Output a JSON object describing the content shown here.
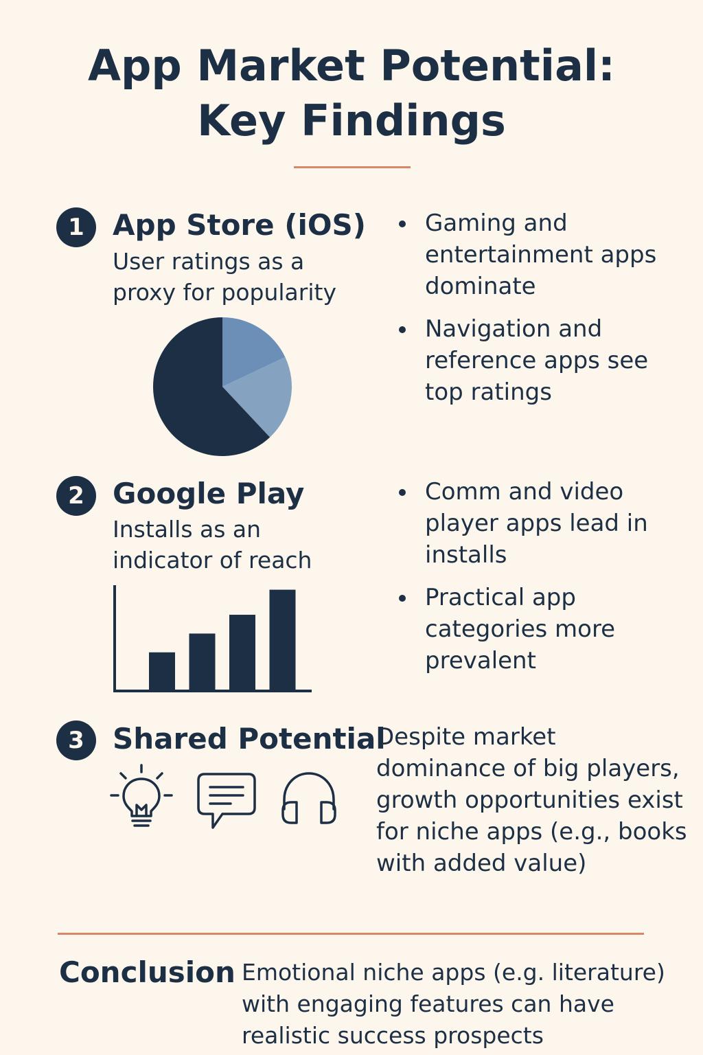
{
  "title": {
    "line1": "App Market Potential:",
    "line2": "Key Findings"
  },
  "sections": [
    {
      "number": "1",
      "title": "App Store (iOS)",
      "subtitle": "User ratings as a proxy for popularity",
      "bullets": [
        "Gaming and entertainment apps dominate",
        "Navigation and reference apps see top ratings"
      ]
    },
    {
      "number": "2",
      "title": "Google Play",
      "subtitle": "Installs as an indicator of reach",
      "bullets": [
        "Comm and video player apps lead in installs",
        "Practical app categories more prevalent"
      ]
    },
    {
      "number": "3",
      "title": "Shared Potential",
      "paragraph": "Despite market dominance of big players, growth opportunities exist for niche apps (e.g., books with added value)"
    }
  ],
  "icons": [
    "lightbulb-icon",
    "chat-bubble-icon",
    "headphones-icon"
  ],
  "conclusion": {
    "label": "Conclusion",
    "text": "Emotional niche apps (e.g. literature) with engaging features can have realistic success prospects"
  },
  "colors": {
    "background": "#fcf6ec",
    "navy": "#1c2f45",
    "accent_rule": "#d98566",
    "pie_light": "#85a3c0",
    "pie_mid": "#6c8fb8"
  },
  "chart_data": [
    {
      "type": "pie",
      "values": [
        62,
        20,
        18
      ],
      "colors": [
        "#1c2f45",
        "#85a3c0",
        "#6c8fb8"
      ]
    },
    {
      "type": "bar",
      "values": [
        37,
        55,
        73,
        97
      ],
      "ylim": [
        0,
        100
      ]
    }
  ]
}
